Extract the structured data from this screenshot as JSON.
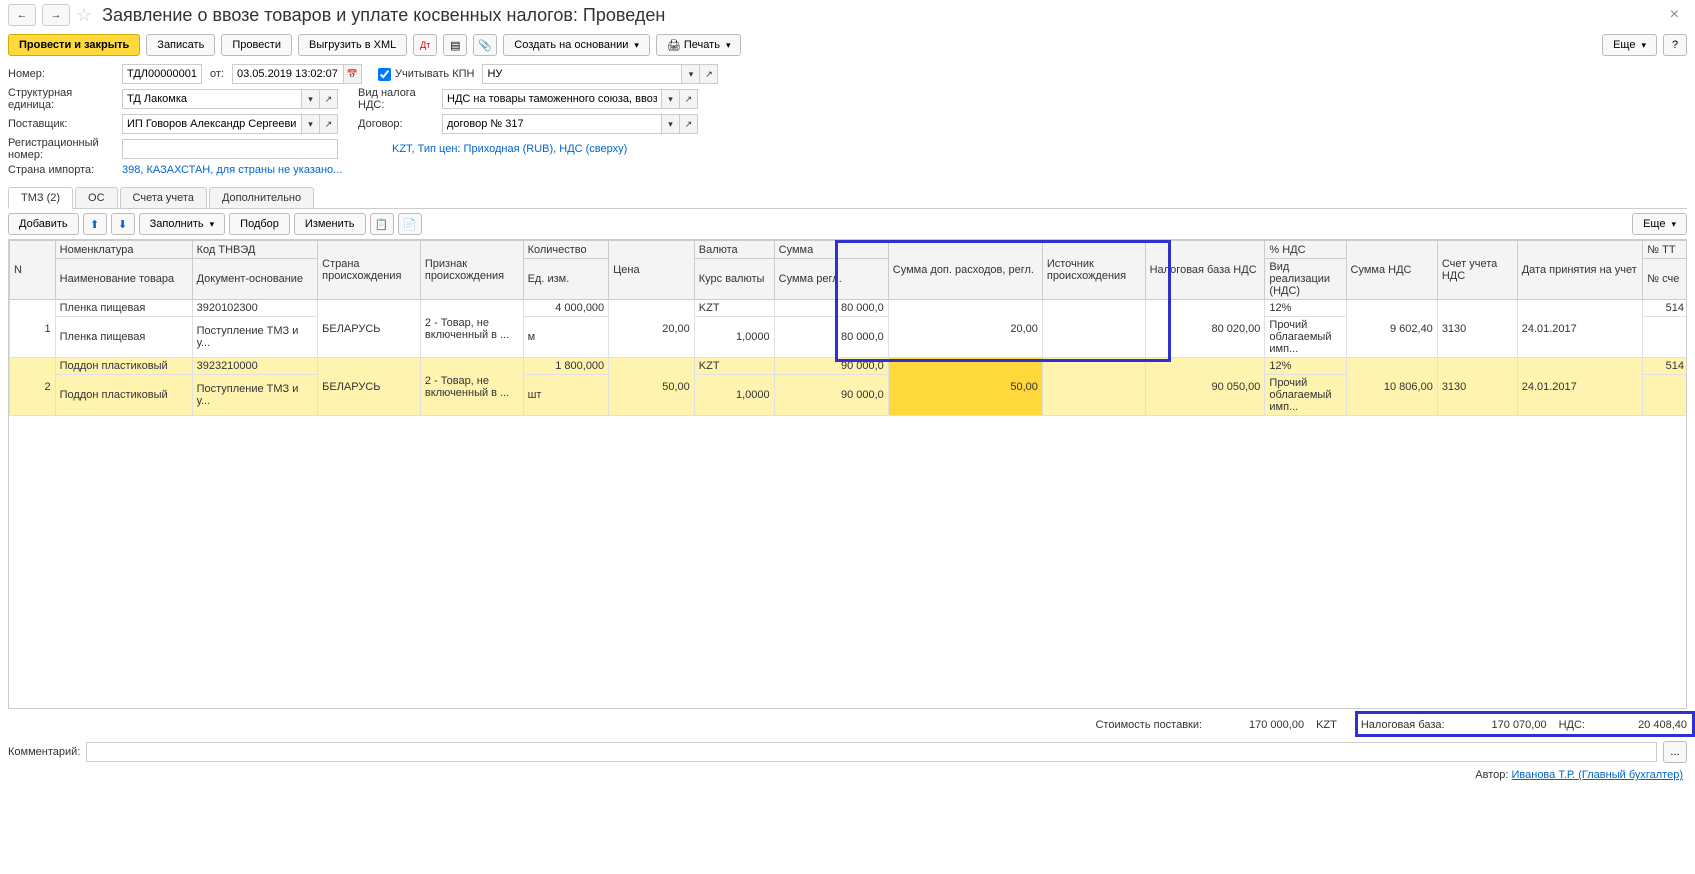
{
  "title": "Заявление о ввозе товаров и уплате косвенных налогов: Проведен",
  "toolbar": {
    "post_close": "Провести и закрыть",
    "write": "Записать",
    "post": "Провести",
    "export_xml": "Выгрузить в XML",
    "create_based": "Создать на основании",
    "print": "Печать",
    "more": "Еще"
  },
  "form": {
    "number_label": "Номер:",
    "number": "ТДЛ00000001",
    "from_label": "от:",
    "date": "03.05.2019 13:02:07",
    "kpn_label": "Учитывать КПН",
    "kpn_value": "НУ",
    "struct_label": "Структурная единица:",
    "struct": "ТД Лакомка",
    "vat_type_label": "Вид налога НДС:",
    "vat_type": "НДС на товары таможенного союза, ввозимые с",
    "supplier_label": "Поставщик:",
    "supplier": "ИП Говоров Александр Сергеевич",
    "contract_label": "Договор:",
    "contract": "договор № 317",
    "contract_info": "KZT, Тип цен: Приходная (RUB), НДС (сверху)",
    "reg_label": "Регистрационный номер:",
    "country_label": "Страна импорта:",
    "country_info": "398, КАЗАХСТАН, для страны не указано..."
  },
  "tabs": {
    "tmz": "ТМЗ (2)",
    "os": "ОС",
    "accounts": "Счета учета",
    "extra": "Дополнительно"
  },
  "tabbar": {
    "add": "Добавить",
    "fill": "Заполнить",
    "select": "Подбор",
    "edit": "Изменить",
    "more": "Еще"
  },
  "headers": {
    "n": "N",
    "nom": "Номенклатура",
    "name": "Наименование товара",
    "tnved": "Код ТНВЭД",
    "doc": "Документ-основание",
    "country": "Страна происхождения",
    "sign": "Признак происхождения",
    "qty": "Количество",
    "uom": "Ед. изм.",
    "price": "Цена",
    "currency": "Валюта",
    "rate": "Курс валюты",
    "sum": "Сумма",
    "sum_reg": "Сумма регл.",
    "extra_sum": "Сумма доп. расходов, регл.",
    "source": "Источник происхождения",
    "tax_base": "Налоговая база НДС",
    "vat_pct": "% НДС",
    "vat_type": "Вид реализации (НДС)",
    "vat_sum": "Сумма НДС",
    "account": "Счет учета НДС",
    "date_acc": "Дата принятия на учет",
    "tt": "№ ТТ",
    "acc_n": "№ сче"
  },
  "rows": [
    {
      "n": "1",
      "nom": "Пленка пищевая",
      "name": "Пленка пищевая",
      "tnved": "3920102300",
      "doc": "Поступление ТМЗ и у...",
      "country": "БЕЛАРУСЬ",
      "sign": "2 - Товар, не включенный в ...",
      "qty": "4 000,000",
      "uom": "м",
      "price": "20,00",
      "currency": "KZT",
      "rate": "1,0000",
      "sum": "80 000,0",
      "sum_reg": "80 000,0",
      "extra": "20,00",
      "tax_base": "80 020,00",
      "vat_pct": "12%",
      "vat_type": "Прочий облагаемый имп...",
      "vat_sum": "9 602,40",
      "account": "3130",
      "date_acc": "24.01.2017",
      "tt": "514"
    },
    {
      "n": "2",
      "nom": "Поддон пластиковый",
      "name": "Поддон пластиковый",
      "tnved": "3923210000",
      "doc": "Поступление ТМЗ и у...",
      "country": "БЕЛАРУСЬ",
      "sign": "2 - Товар, не включенный в ...",
      "qty": "1 800,000",
      "uom": "шт",
      "price": "50,00",
      "currency": "KZT",
      "rate": "1,0000",
      "sum": "90 000,0",
      "sum_reg": "90 000,0",
      "extra": "50,00",
      "tax_base": "90 050,00",
      "vat_pct": "12%",
      "vat_type": "Прочий облагаемый имп...",
      "vat_sum": "10 806,00",
      "account": "3130",
      "date_acc": "24.01.2017",
      "tt": "514"
    }
  ],
  "totals": {
    "cost_label": "Стоимость поставки:",
    "cost": "170 000,00",
    "cur": "KZT",
    "base_label": "Налоговая база:",
    "base": "170 070,00",
    "vat_label": "НДС:",
    "vat": "20 408,40"
  },
  "comment_label": "Комментарий:",
  "author_label": "Автор:",
  "author": "Иванова Т.Р. (Главный бухгалтер)"
}
